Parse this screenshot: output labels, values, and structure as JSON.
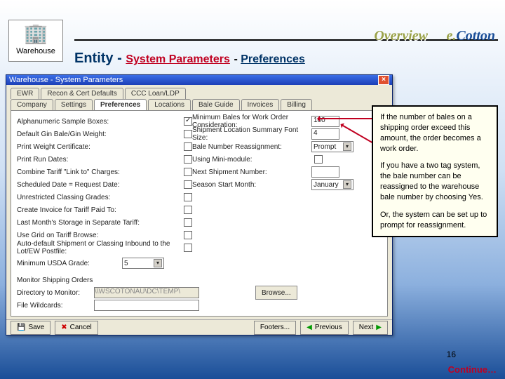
{
  "header": {
    "module_icon_label": "Warehouse",
    "overview": "Overview",
    "brand_prefix": "e.",
    "brand": "Cotton",
    "subtitle_entity": "Entity",
    "subtitle_sep": " - ",
    "subtitle_system_params": "System Parameters",
    "subtitle_dash": " - ",
    "subtitle_preferences": "Preferences"
  },
  "window": {
    "title": "Warehouse - System Parameters",
    "tabs_row1": [
      "EWR",
      "Recon & Cert Defaults",
      "CCC Loan/LDP"
    ],
    "tabs_row2": [
      "Company",
      "Settings",
      "Preferences",
      "Locations",
      "Bale Guide",
      "Invoices",
      "Billing"
    ],
    "active_tab": "Preferences",
    "left_labels": [
      "Alphanumeric Sample Boxes:",
      "Default Gin Bale/Gin Weight:",
      "Print Weight Certificate:",
      "Print Run Dates:",
      "Combine Tariff \"Link to\" Charges:",
      "Scheduled Date = Request Date:",
      "Unrestricted Classing Grades:",
      "Create Invoice for Tariff Paid To:",
      "Last Month's Storage in Separate Tariff:",
      "Use Grid on Tariff Browse:",
      "Auto-default Shipment or Classing Inbound to the Lot/EW Postfile:"
    ],
    "left_checked": [
      true,
      false,
      false,
      false,
      false,
      false,
      false,
      false,
      false,
      false,
      false
    ],
    "right_rows": [
      {
        "label": "Minimum Bales for Work Order Consideration:",
        "type": "text",
        "value": "100"
      },
      {
        "label": "Shipment Location Summary Font Size:",
        "type": "text",
        "value": "4"
      },
      {
        "label": "Bale Number Reassignment:",
        "type": "combo",
        "value": "Prompt"
      },
      {
        "label": "Using Mini-module:",
        "type": "check",
        "value": false
      },
      {
        "label": "Next Shipment Number:",
        "type": "text",
        "value": ""
      },
      {
        "label": "Season Start Month:",
        "type": "combo",
        "value": "January"
      }
    ],
    "min_usda_label": "Minimum USDA Grade:",
    "min_usda_value": "5",
    "monitor_label": "Monitor Shipping Orders",
    "directory_label": "Directory to Monitor:",
    "directory_value": "\\\\WSCOTONAU\\DC\\TEMP\\",
    "browse_btn": "Browse...",
    "file_label": "File Wildcards:",
    "buttons": {
      "save": "Save",
      "cancel": "Cancel",
      "footers": "Footers...",
      "previous": "Previous",
      "next": "Next"
    }
  },
  "annotations": {
    "p1": "If the number of bales on a shipping order exceed this amount, the order becomes a work order.",
    "p2": "If you have a two tag system, the bale number can be reassigned to the warehouse bale number by choosing Yes.",
    "p3": "Or, the system can be set up to prompt for reassignment."
  },
  "footer": {
    "page": "16",
    "continue": "Continue…"
  }
}
